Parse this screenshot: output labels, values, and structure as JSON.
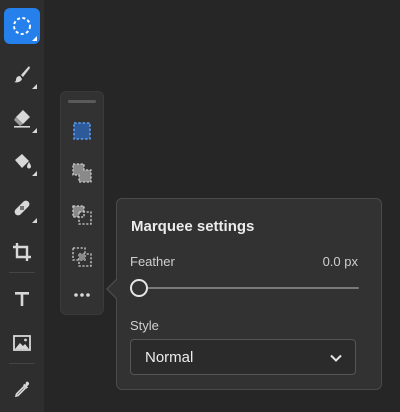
{
  "toolbar": {
    "tools": [
      {
        "name": "marquee-tool",
        "icon": "marquee-circle-icon",
        "active": true
      },
      {
        "name": "brush-tool",
        "icon": "brush-icon"
      },
      {
        "name": "eraser-tool",
        "icon": "eraser-icon"
      },
      {
        "name": "paint-bucket-tool",
        "icon": "paint-bucket-icon"
      },
      {
        "name": "healing-tool",
        "icon": "bandage-icon"
      },
      {
        "name": "crop-tool",
        "icon": "crop-icon"
      },
      {
        "name": "type-tool",
        "icon": "type-icon",
        "glyph": "T"
      },
      {
        "name": "place-image-tool",
        "icon": "image-icon"
      },
      {
        "name": "eyedropper-tool",
        "icon": "eyedropper-icon"
      }
    ],
    "accent_color": "#2680eb"
  },
  "flyout": {
    "items": [
      {
        "name": "new-selection",
        "icon": "new-selection-icon",
        "selected": true
      },
      {
        "name": "add-to-selection",
        "icon": "add-selection-icon"
      },
      {
        "name": "subtract-from-selection",
        "icon": "subtract-selection-icon"
      },
      {
        "name": "intersect-selection",
        "icon": "intersect-selection-icon"
      },
      {
        "name": "more-options",
        "icon": "more-horizontal-icon"
      }
    ]
  },
  "marquee_settings": {
    "title": "Marquee settings",
    "feather_label": "Feather",
    "feather_value": "0.0 px",
    "feather_level": 0,
    "style_label": "Style",
    "style_value": "Normal"
  }
}
